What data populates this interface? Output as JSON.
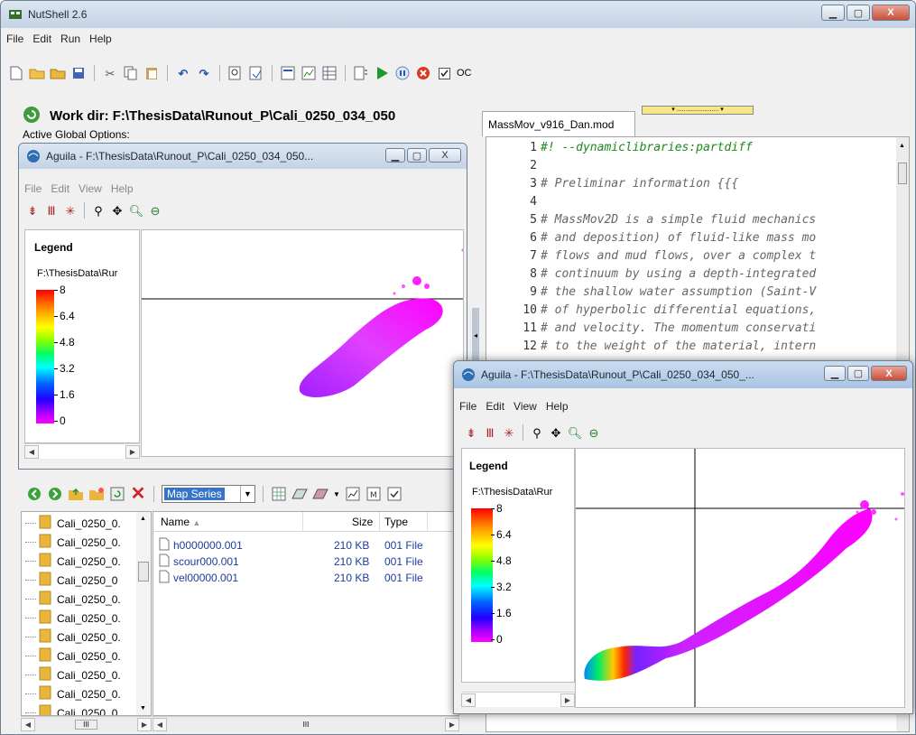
{
  "main": {
    "title": "NutShell 2.6",
    "menu": [
      "File",
      "Edit",
      "Run",
      "Help"
    ],
    "oc_label": "OC",
    "workdir_label": "Work dir: F:\\ThesisData\\Runout_P\\Cali_0250_034_050",
    "active_global": "Active Global Options:",
    "editor_tab": "MassMov_v916_Dan.mod",
    "accent": "#2a6fb8"
  },
  "editor": {
    "lines": [
      {
        "n": "1",
        "t": "#! --dynamiclibraries:partdiff",
        "green": true
      },
      {
        "n": "2",
        "t": ""
      },
      {
        "n": "3",
        "t": "# Preliminar information {{{"
      },
      {
        "n": "4",
        "t": ""
      },
      {
        "n": "5",
        "t": "# MassMov2D is a simple fluid mechanics"
      },
      {
        "n": "6",
        "t": "# and deposition) of fluid-like mass mo"
      },
      {
        "n": "7",
        "t": "# flows and mud flows, over a complex t"
      },
      {
        "n": "8",
        "t": "# continuum by using a depth-integrated"
      },
      {
        "n": "9",
        "t": "# the shallow water assumption (Saint-V"
      },
      {
        "n": "10",
        "t": "# of hyperbolic differential equations,"
      },
      {
        "n": "11",
        "t": "# and velocity. The momentum conservati"
      },
      {
        "n": "12",
        "t": "# to the weight of the material, intern"
      }
    ]
  },
  "browser": {
    "map_series": "Map Series",
    "tree_items": [
      "Cali_0250_0.",
      "Cali_0250_0.",
      "Cali_0250_0.",
      "Cali_0250_0",
      "Cali_0250_0.",
      "Cali_0250_0.",
      "Cali_0250_0.",
      "Cali_0250_0.",
      "Cali_0250_0.",
      "Cali_0250_0.",
      "Cali_0250_0"
    ],
    "columns": {
      "name": "Name",
      "size": "Size",
      "type": "Type"
    },
    "files": [
      {
        "name": "h0000000.001",
        "size": "210 KB",
        "type": "001 File"
      },
      {
        "name": "scour000.001",
        "size": "210 KB",
        "type": "001 File"
      },
      {
        "name": "vel00000.001",
        "size": "210 KB",
        "type": "001 File"
      }
    ],
    "scroll_mid": "III"
  },
  "aguila1": {
    "title": "Aguila - F:\\ThesisData\\Runout_P\\Cali_0250_034_050...",
    "menu": [
      "File",
      "Edit",
      "View",
      "Help"
    ],
    "legend_title": "Legend",
    "legend_path": "F:\\ThesisData\\Rur",
    "ticks": [
      "8",
      "6.4",
      "4.8",
      "3.2",
      "1.6",
      "0"
    ]
  },
  "aguila2": {
    "title": "Aguila - F:\\ThesisData\\Runout_P\\Cali_0250_034_050_...",
    "menu": [
      "File",
      "Edit",
      "View",
      "Help"
    ],
    "legend_title": "Legend",
    "legend_path": "F:\\ThesisData\\Rur",
    "ticks": [
      "8",
      "6.4",
      "4.8",
      "3.2",
      "1.6",
      "0"
    ]
  }
}
